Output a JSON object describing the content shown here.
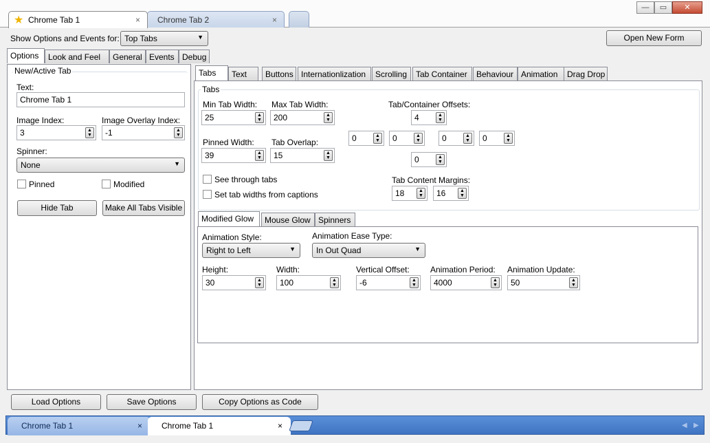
{
  "window": {
    "tabs": [
      {
        "label": "Chrome Tab 1",
        "close": "×"
      },
      {
        "label": "Chrome Tab 2",
        "close": "×"
      }
    ],
    "controls": {
      "minimize": "—",
      "maximize": "▭",
      "close": "✕"
    }
  },
  "header": {
    "show_label": "Show Options and Events for:",
    "show_value": "Top Tabs",
    "open_form_button": "Open New Form"
  },
  "left_tabs": [
    "Options",
    "Look and Feel",
    "General",
    "Events",
    "Debug"
  ],
  "new_active_tab": {
    "title": "New/Active Tab",
    "text_label": "Text:",
    "text_value": "Chrome Tab 1",
    "image_index_label": "Image Index:",
    "image_index_value": "3",
    "overlay_label": "Image Overlay Index:",
    "overlay_value": "-1",
    "spinner_label": "Spinner:",
    "spinner_value": "None",
    "pinned_label": "Pinned",
    "modified_label": "Modified",
    "hide_tab_button": "Hide Tab",
    "make_visible_button": "Make All Tabs Visible"
  },
  "right_tabs": [
    "Tabs",
    "Text",
    "Buttons",
    "Internationlization",
    "Scrolling",
    "Tab Container",
    "Behaviour",
    "Animation",
    "Drag Drop"
  ],
  "tabs_group": {
    "title": "Tabs",
    "min_width_label": "Min Tab Width:",
    "min_width_value": "25",
    "max_width_label": "Max Tab Width:",
    "max_width_value": "200",
    "offsets_label": "Tab/Container Offsets:",
    "offset_top": "4",
    "offset_a": "0",
    "offset_b": "0",
    "offset_c": "0",
    "offset_d": "0",
    "offset_bottom": "0",
    "pinned_width_label": "Pinned Width:",
    "pinned_width_value": "39",
    "overlap_label": "Tab Overlap:",
    "overlap_value": "15",
    "see_through_label": "See through tabs",
    "set_widths_label": "Set tab widths from captions",
    "margins_label": "Tab Content Margins:",
    "margin_a": "18",
    "margin_b": "16"
  },
  "glow_tabs": [
    "Modified Glow",
    "Mouse Glow",
    "Spinners"
  ],
  "glow": {
    "anim_style_label": "Animation Style:",
    "anim_style_value": "Right to Left",
    "ease_label": "Animation Ease Type:",
    "ease_value": "In Out Quad",
    "height_label": "Height:",
    "height_value": "30",
    "width_label": "Width:",
    "width_value": "100",
    "voffset_label": "Vertical Offset:",
    "voffset_value": "-6",
    "period_label": "Animation Period:",
    "period_value": "4000",
    "update_label": "Animation Update:",
    "update_value": "50"
  },
  "footer": {
    "load_button": "Load Options",
    "save_button": "Save Options",
    "copy_button": "Copy Options as Code"
  },
  "bottom_tabs": [
    {
      "label": "Chrome Tab 1",
      "close": "×"
    },
    {
      "label": "Chrome Tab 1",
      "close": "×"
    }
  ],
  "colors": {
    "accent": "#3f74c3",
    "star": "#f0b400"
  }
}
